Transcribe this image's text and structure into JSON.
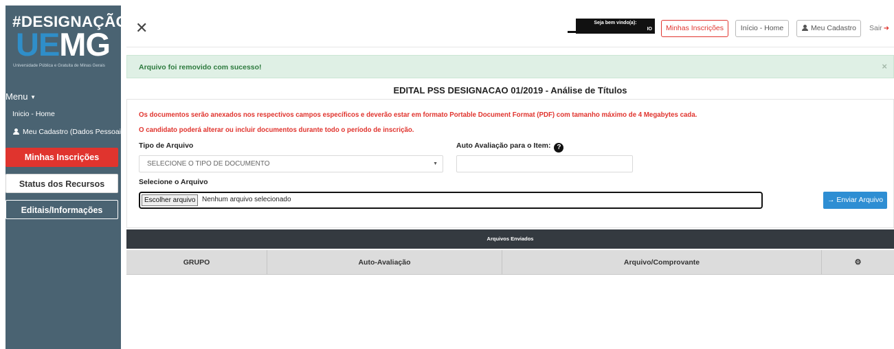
{
  "brand": {
    "hashtag": "#DESIGNAÇÃO",
    "logo_ue": "UE",
    "logo_mg": "MG",
    "subtitle": "Universidade Pública e Gratuita de Minas Gerais"
  },
  "sidebar": {
    "menu_label": "Menu",
    "links": [
      {
        "label": "Inicio - Home"
      },
      {
        "label": "Meu Cadastro (Dados Pessoais)"
      }
    ],
    "buttons": [
      {
        "label": "Minhas Inscrições"
      },
      {
        "label": "Status dos Recursos"
      },
      {
        "label": "Editais/Informações"
      }
    ]
  },
  "topbar": {
    "welcome": "Seja bem vindo(a):",
    "welcome_name_tail": "IO",
    "my_applications": "Minhas Inscrições",
    "home": "Início - Home",
    "my_profile": "Meu Cadastro",
    "logout": "Sair"
  },
  "alert": {
    "message": "Arquivo foi removido com sucesso!",
    "close": "×"
  },
  "page": {
    "title": "EDITAL PSS DESIGNACAO 01/2019 - Análise de Títulos"
  },
  "form": {
    "warning_1": "Os documentos serão anexados nos respectivos campos específicos e deverão estar em formato Portable Document Format (PDF) com tamanho máximo de 4 Megabytes cada.",
    "warning_2": "O candidato poderá alterar ou incluir documentos durante todo o período de inscrição.",
    "file_type_label": "Tipo de Arquivo",
    "file_type_value": "SELECIONE O TIPO DE DOCUMENTO",
    "self_eval_label": "Auto Avaliação para o Item:",
    "self_eval_value": "",
    "select_file_label": "Selecione o Arquivo",
    "choose_file_button": "Escolher arquivo",
    "no_file_text": "Nenhum arquivo selecionado",
    "send_button": "Enviar Arquivo"
  },
  "table": {
    "caption": "Arquivos Enviados",
    "columns": [
      "GRUPO",
      "Auto-Avaliação",
      "Arquivo/Comprovante"
    ],
    "rows": []
  },
  "colors": {
    "sidebar": "#4a6372",
    "accent_red": "#e0342e",
    "primary_blue": "#2e8ed3",
    "table_header": "#343a40",
    "alert_bg": "#dff0e5",
    "alert_text": "#2d7a3e"
  },
  "icons": [
    "close-icon",
    "user-icon",
    "exit-icon",
    "help-icon",
    "arrow-right-icon",
    "chevron-down-icon",
    "gears-icon"
  ]
}
